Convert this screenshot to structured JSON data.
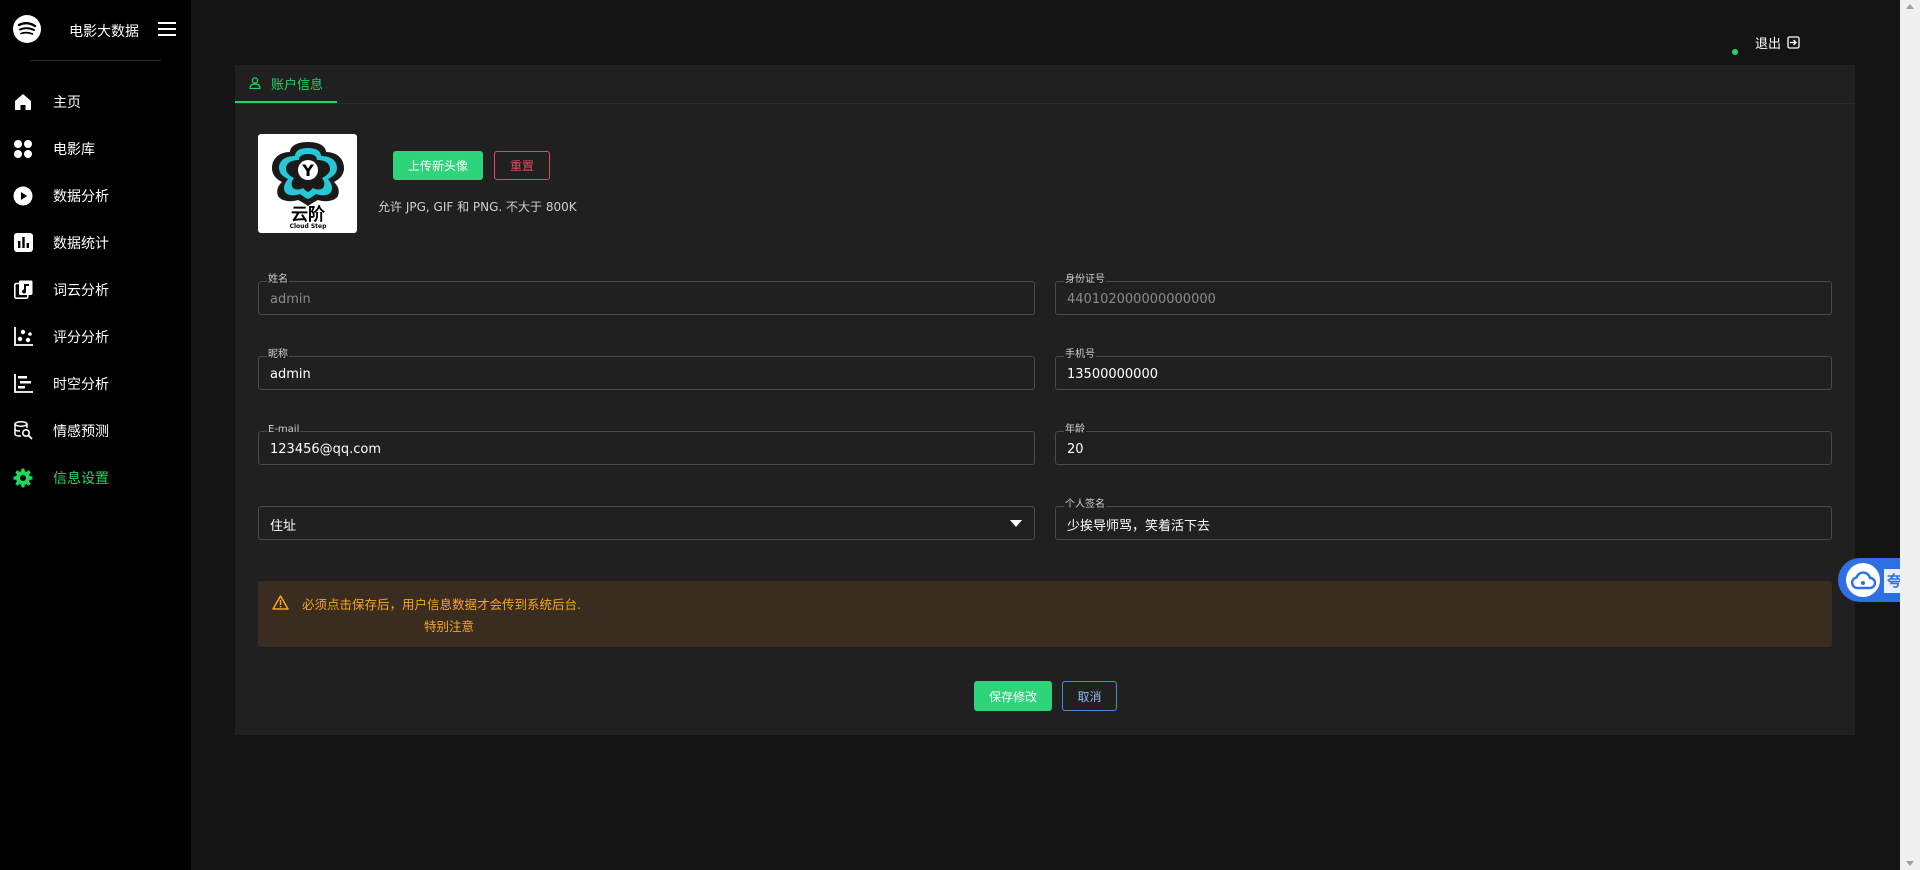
{
  "app": {
    "title": "电影大数据"
  },
  "nav": {
    "items": [
      {
        "label": "主页",
        "icon": "home-icon"
      },
      {
        "label": "电影库",
        "icon": "grid-icon"
      },
      {
        "label": "数据分析",
        "icon": "play-circle-icon"
      },
      {
        "label": "数据统计",
        "icon": "bar-chart-icon"
      },
      {
        "label": "词云分析",
        "icon": "book-icon"
      },
      {
        "label": "评分分析",
        "icon": "scatter-icon"
      },
      {
        "label": "时空分析",
        "icon": "timeline-icon"
      },
      {
        "label": "情感预测",
        "icon": "search-data-icon"
      },
      {
        "label": "信息设置",
        "icon": "gear-icon",
        "active": true
      }
    ]
  },
  "header": {
    "logout_label": "退出"
  },
  "tab": {
    "label": "账户信息"
  },
  "avatar": {
    "brand_text": "云阶",
    "brand_sub": "Cloud Step",
    "letter": "Y"
  },
  "upload": {
    "upload_label": "上传新头像",
    "reset_label": "重置",
    "hint": "允许 JPG, GIF 和 PNG. 不大于 800K"
  },
  "form": {
    "name": {
      "label": "姓名",
      "value": "admin"
    },
    "id_card": {
      "label": "身份证号",
      "value": "440102000000000000"
    },
    "nickname": {
      "label": "昵称",
      "value": "admin"
    },
    "phone": {
      "label": "手机号",
      "value": "13500000000"
    },
    "email": {
      "label": "E-mail",
      "value": "123456@qq.com"
    },
    "age": {
      "label": "年龄",
      "value": "20"
    },
    "address": {
      "value": "住址"
    },
    "signature": {
      "label": "个人签名",
      "value": "少挨导师骂，笑着活下去"
    }
  },
  "warning": {
    "line1": "必须点击保存后，用户信息数据才会传到系统后台.",
    "line2": "特别注意"
  },
  "actions": {
    "save_label": "保存修改",
    "cancel_label": "取消"
  },
  "float_widget": {
    "text": "夸"
  },
  "colors": {
    "accent": "#1ed760",
    "sidebar_bg": "#000000",
    "card_bg": "#202020",
    "warning": "#f5a623",
    "danger": "#e04b5b"
  }
}
